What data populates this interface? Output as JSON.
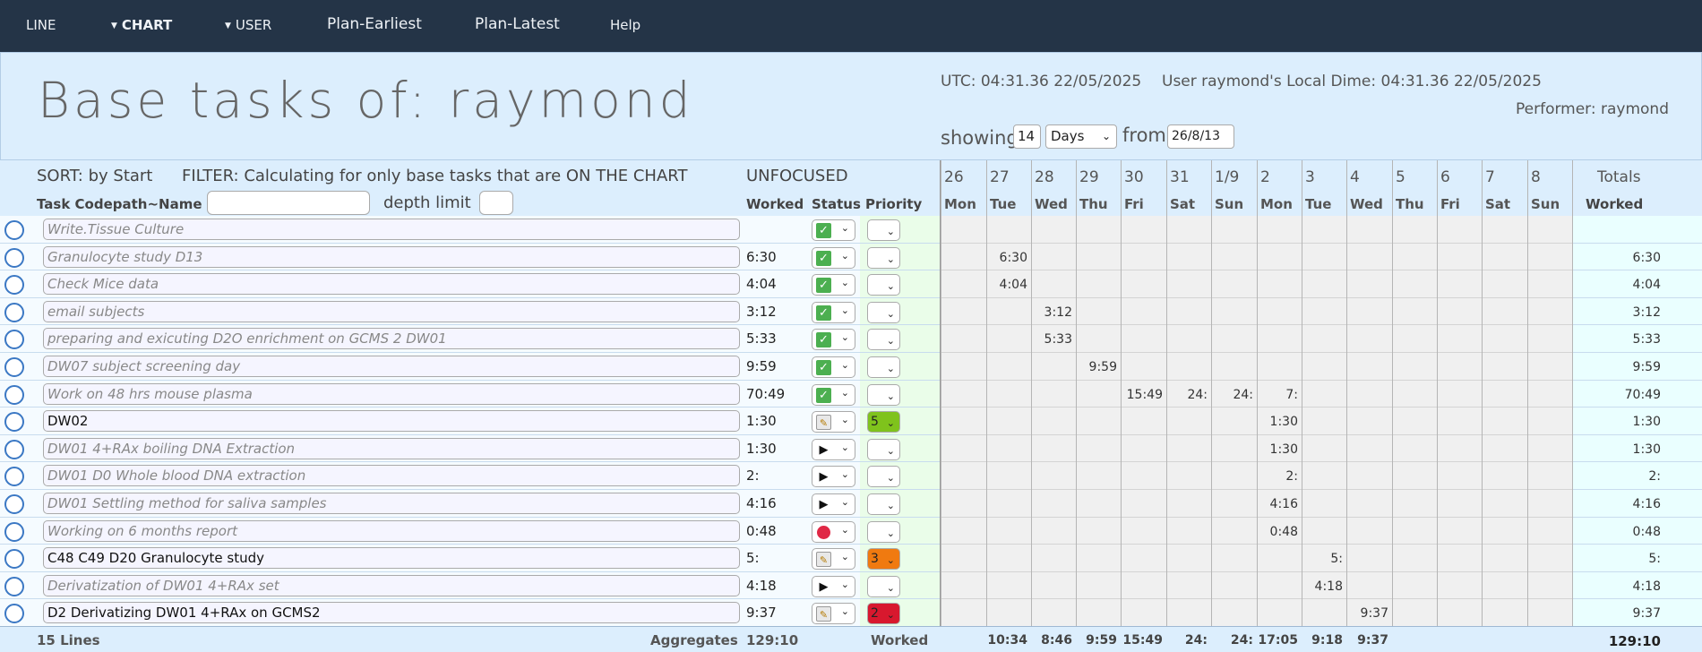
{
  "nav": {
    "items": [
      {
        "label": "LINE",
        "caret": false
      },
      {
        "label": "CHART",
        "caret": true
      },
      {
        "label": "USER",
        "caret": true
      },
      {
        "label": "Plan-Earliest",
        "caret": false
      },
      {
        "label": "Plan-Latest",
        "caret": false
      },
      {
        "label": "Help",
        "caret": false
      }
    ]
  },
  "header": {
    "title": "Base tasks of: raymond",
    "utc": "UTC: 04:31.36 22/05/2025",
    "local_time": "User raymond's Local Dime: 04:31.36 22/05/2025",
    "performer": "Performer: raymond",
    "showing_label": "showing",
    "showing_value": "14",
    "unit_select": "Days",
    "from_label": "from",
    "from_value": "26/8/13"
  },
  "grid": {
    "sort_label": "SORT: by Start",
    "filter_label": "FILTER: Calculating for only base tasks that are ON THE CHART",
    "focus_label": "UNFOCUSED",
    "col_task": "Task Codepath~Name",
    "depth_label": "depth limit",
    "col_worked": "Worked",
    "col_status": "Status",
    "col_priority": "Priority",
    "col_totals": "Totals",
    "col_totals_worked": "Worked",
    "days": [
      {
        "date": "26",
        "dow": "Mon"
      },
      {
        "date": "27",
        "dow": "Tue"
      },
      {
        "date": "28",
        "dow": "Wed"
      },
      {
        "date": "29",
        "dow": "Thu"
      },
      {
        "date": "30",
        "dow": "Fri"
      },
      {
        "date": "31",
        "dow": "Sat"
      },
      {
        "date": "1/9",
        "dow": "Sun"
      },
      {
        "date": "2",
        "dow": "Mon"
      },
      {
        "date": "3",
        "dow": "Tue"
      },
      {
        "date": "4",
        "dow": "Wed"
      },
      {
        "date": "5",
        "dow": "Thu"
      },
      {
        "date": "6",
        "dow": "Fri"
      },
      {
        "date": "7",
        "dow": "Sat"
      },
      {
        "date": "8",
        "dow": "Sun"
      }
    ]
  },
  "rows": [
    {
      "name": "Write.Tissue Culture",
      "italic": true,
      "worked": "",
      "status": "check",
      "priority": "",
      "cells": {},
      "total": ""
    },
    {
      "name": "Granulocyte study D13",
      "italic": true,
      "worked": "6:30",
      "status": "check",
      "priority": "",
      "cells": {
        "1": "6:30"
      },
      "total": "6:30"
    },
    {
      "name": "Check Mice data",
      "italic": true,
      "worked": "4:04",
      "status": "check",
      "priority": "",
      "cells": {
        "1": "4:04"
      },
      "total": "4:04"
    },
    {
      "name": "email subjects",
      "italic": true,
      "worked": "3:12",
      "status": "check",
      "priority": "",
      "cells": {
        "2": "3:12"
      },
      "total": "3:12"
    },
    {
      "name": "preparing and exicuting D2O enrichment on GCMS 2 DW01",
      "italic": true,
      "worked": "5:33",
      "status": "check",
      "priority": "",
      "cells": {
        "2": "5:33"
      },
      "total": "5:33"
    },
    {
      "name": "DW07 subject screening day",
      "italic": true,
      "worked": "9:59",
      "status": "check",
      "priority": "",
      "cells": {
        "3": "9:59"
      },
      "total": "9:59"
    },
    {
      "name": "Work on 48 hrs mouse plasma",
      "italic": true,
      "worked": "70:49",
      "status": "check",
      "priority": "",
      "cells": {
        "4": "15:49",
        "5": "24:",
        "6": "24:",
        "7": "7:"
      },
      "total": "70:49"
    },
    {
      "name": "DW02",
      "italic": false,
      "worked": "1:30",
      "status": "note",
      "priority": "5",
      "priority_color": "#7fc31c",
      "cells": {
        "7": "1:30"
      },
      "total": "1:30"
    },
    {
      "name": "DW01 4+RAx boiling DNA Extraction",
      "italic": true,
      "worked": "1:30",
      "status": "play",
      "priority": "",
      "cells": {
        "7": "1:30"
      },
      "total": "1:30"
    },
    {
      "name": "DW01 D0 Whole blood DNA extraction",
      "italic": true,
      "worked": "2:",
      "status": "play",
      "priority": "",
      "cells": {
        "7": "2:"
      },
      "total": "2:"
    },
    {
      "name": "DW01 Settling method for saliva samples",
      "italic": true,
      "worked": "4:16",
      "status": "play",
      "priority": "",
      "cells": {
        "7": "4:16"
      },
      "total": "4:16"
    },
    {
      "name": "Working on 6 months report",
      "italic": true,
      "worked": "0:48",
      "status": "dot",
      "priority": "",
      "cells": {
        "7": "0:48"
      },
      "total": "0:48"
    },
    {
      "name": "C48  C49 D20 Granulocyte study",
      "italic": false,
      "worked": "5:",
      "status": "note",
      "priority": "3",
      "priority_color": "#f07a10",
      "cells": {
        "8": "5:"
      },
      "total": "5:"
    },
    {
      "name": "Derivatization of DW01 4+RAx set",
      "italic": true,
      "worked": "4:18",
      "status": "play",
      "priority": "",
      "cells": {
        "8": "4:18"
      },
      "total": "4:18"
    },
    {
      "name": "D2 Derivatizing DW01 4+RAx on GCMS2",
      "italic": false,
      "worked": "9:37",
      "status": "note",
      "priority": "2",
      "priority_color": "#d8182e",
      "cells": {
        "9": "9:37"
      },
      "total": "9:37"
    }
  ],
  "footer": {
    "lines": "15 Lines",
    "aggregates": "Aggregates",
    "worked_total": "129:10",
    "worked_label": "Worked",
    "day_totals": [
      "",
      "10:34",
      "8:46",
      "9:59",
      "15:49",
      "24:",
      "24:",
      "17:05",
      "9:18",
      "9:37",
      "",
      "",
      "",
      ""
    ],
    "grand_total": "129:10"
  },
  "colors": {
    "nav_bg": "#243447",
    "header_bg": "#dceefd",
    "row_bg": "#f0f0f0",
    "left_row_bg": "#f5fbff",
    "status_col_bg": "#eafde9",
    "totals_bg": "#eaffff",
    "radio": "#3b78c4",
    "check": "#4caf50",
    "dot": "#e02845"
  },
  "status_icons": {
    "check": "check-icon",
    "play": "play-icon",
    "dot": "red-dot-icon",
    "note": "note-icon"
  }
}
